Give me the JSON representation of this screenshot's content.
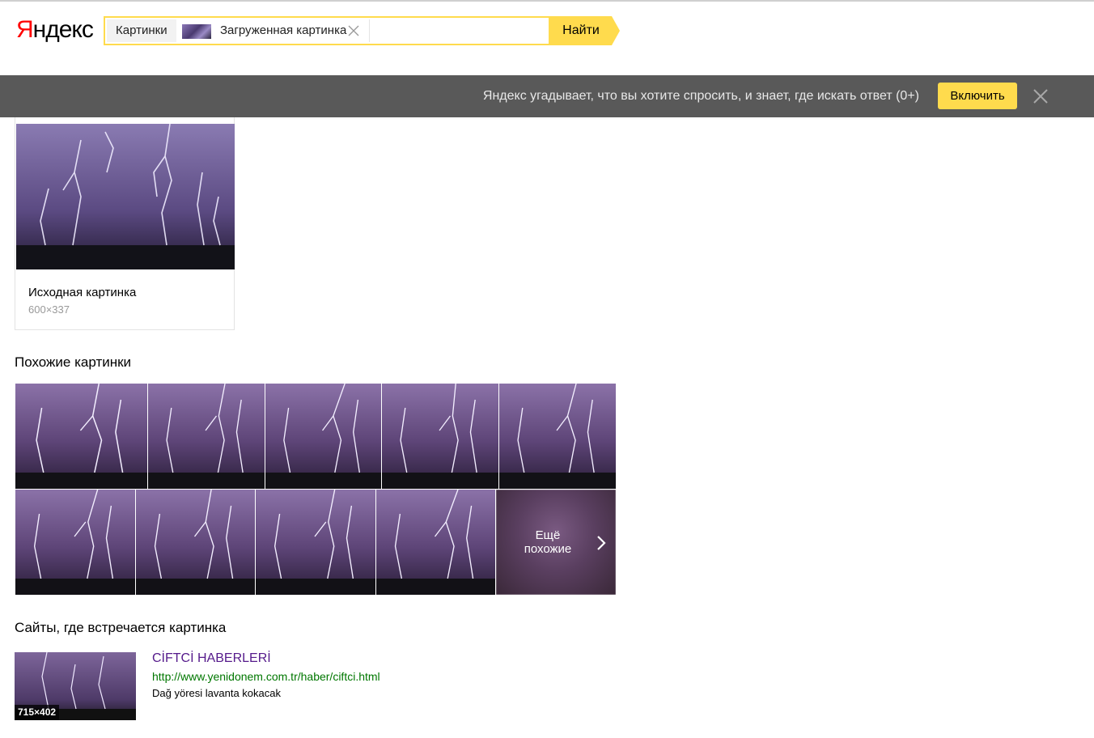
{
  "header": {
    "logo_first": "Я",
    "logo_rest": "ндекс",
    "search_tab": "Картинки",
    "uploaded_label": "Загруженная картинка",
    "search_value": "",
    "find_button": "Найти"
  },
  "promo": {
    "text": "Яндекс угадывает, что вы хотите спросить, и знает, где искать ответ (0+)",
    "button": "Включить"
  },
  "original": {
    "label": "Исходная картинка",
    "size": "600×337"
  },
  "similar": {
    "title": "Похожие картинки",
    "more_label": "Ещё похожие"
  },
  "sites": {
    "title": "Сайты, где встречается картинка",
    "items": [
      {
        "title": "CİFTCİ HABERLERİ",
        "url": "http://www.yenidonem.com.tr/haber/ciftci.html",
        "description": "Dağ yöresi lavanta kokacak",
        "size": "715×402"
      }
    ]
  },
  "colors": {
    "accent": "#ffdb4d",
    "promo_bg": "#595959",
    "link_visited": "#551a8b",
    "url_green": "#007700",
    "logo_red": "#ff0000"
  },
  "icons": [
    "close-icon",
    "chevron-right-icon"
  ]
}
